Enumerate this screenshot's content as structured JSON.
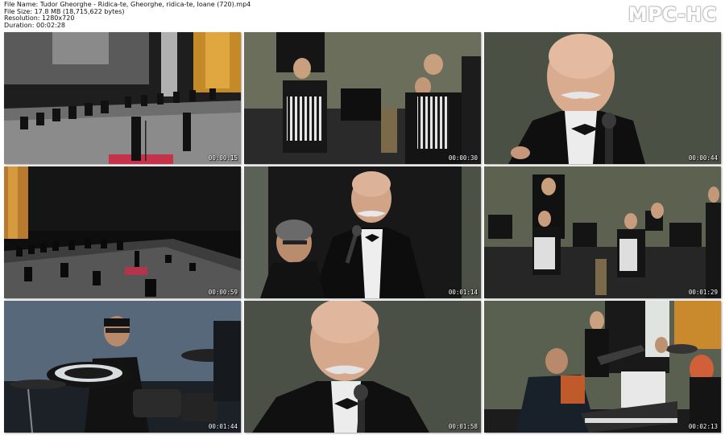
{
  "info": {
    "file_name": "File Name: Tudor Gheorghe - Ridica-te, Gheorghe, ridica-te, Ioane (720).mp4",
    "file_size": "File Size: 17.8 MB (18,715,622 bytes)",
    "resolution": "Resolution: 1280x720",
    "duration": "Duration: 00:02:28"
  },
  "brand": "MPC-HC",
  "thumbnails": [
    {
      "timestamp": "00:00:15",
      "scene": "orchestra-wide-stage"
    },
    {
      "timestamp": "00:00:30",
      "scene": "accordion-players"
    },
    {
      "timestamp": "00:00:44",
      "scene": "singer-closeup"
    },
    {
      "timestamp": "00:00:59",
      "scene": "hall-wide-dark"
    },
    {
      "timestamp": "00:01:14",
      "scene": "singer-with-microphone"
    },
    {
      "timestamp": "00:01:29",
      "scene": "accordion-ensemble"
    },
    {
      "timestamp": "00:01:44",
      "scene": "drummer"
    },
    {
      "timestamp": "00:01:58",
      "scene": "singer-closeup-microphone"
    },
    {
      "timestamp": "00:02:13",
      "scene": "keyboard-and-guitar"
    }
  ]
}
